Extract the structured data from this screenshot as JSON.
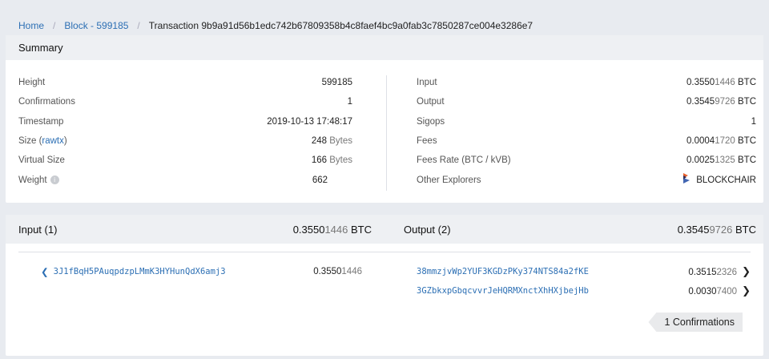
{
  "breadcrumb": {
    "home": "Home",
    "block": "Block - 599185",
    "current": "Transaction 9b9a91d56b1edc742b67809358b4c8faef4bc9a0fab3c7850287ce004e3286e7"
  },
  "summary": {
    "title": "Summary",
    "left": {
      "height": {
        "label": "Height",
        "value": "599185"
      },
      "confirmations": {
        "label": "Confirmations",
        "value": "1"
      },
      "timestamp": {
        "label": "Timestamp",
        "value": "2019-10-13 17:48:17"
      },
      "size": {
        "label_prefix": "Size (",
        "label_link": "rawtx",
        "label_suffix": ")",
        "value": "248",
        "unit": "Bytes"
      },
      "vsize": {
        "label": "Virtual Size",
        "value": "166",
        "unit": "Bytes"
      },
      "weight": {
        "label": "Weight",
        "value": "662",
        "info_icon": "info-icon"
      }
    },
    "right": {
      "input": {
        "label": "Input",
        "value_main": "0.3550",
        "value_dim": "1446",
        "unit": "BTC"
      },
      "output": {
        "label": "Output",
        "value_main": "0.3545",
        "value_dim": "9726",
        "unit": "BTC"
      },
      "sigops": {
        "label": "Sigops",
        "value": "1"
      },
      "fees": {
        "label": "Fees",
        "value_main": "0.0004",
        "value_dim": "1720",
        "unit": "BTC"
      },
      "fee_rate": {
        "label": "Fees Rate (BTC / kVB)",
        "value_main": "0.0025",
        "value_dim": "1325",
        "unit": "BTC"
      },
      "explorers": {
        "label": "Other Explorers",
        "link": "BLOCKCHAIR",
        "icon": "blockchair-logo-icon"
      }
    }
  },
  "tx": {
    "input_header": "Input (1)",
    "input_total_main": "0.3550",
    "input_total_dim": "1446",
    "output_header": "Output (2)",
    "output_total_main": "0.3545",
    "output_total_dim": "9726",
    "unit": "BTC",
    "inputs": [
      {
        "address": "3J1fBqH5PAuqpdzpLMmK3HYHunQdX6amj3",
        "value_main": "0.3550",
        "value_dim": "1446"
      }
    ],
    "outputs": [
      {
        "address": "38mmzjvWp2YUF3KGDzPKy374NTS84a2fKE",
        "value_main": "0.3515",
        "value_dim": "2326"
      },
      {
        "address": "3GZbkxpGbqcvvrJeHQRMXnctXhHXjbejHb",
        "value_main": "0.0030",
        "value_dim": "7400"
      }
    ],
    "confirmations_badge": "1 Confirmations"
  },
  "colors": {
    "link": "#2c6fb4",
    "background": "#e8ebf0",
    "header_bg": "#eef0f3"
  }
}
